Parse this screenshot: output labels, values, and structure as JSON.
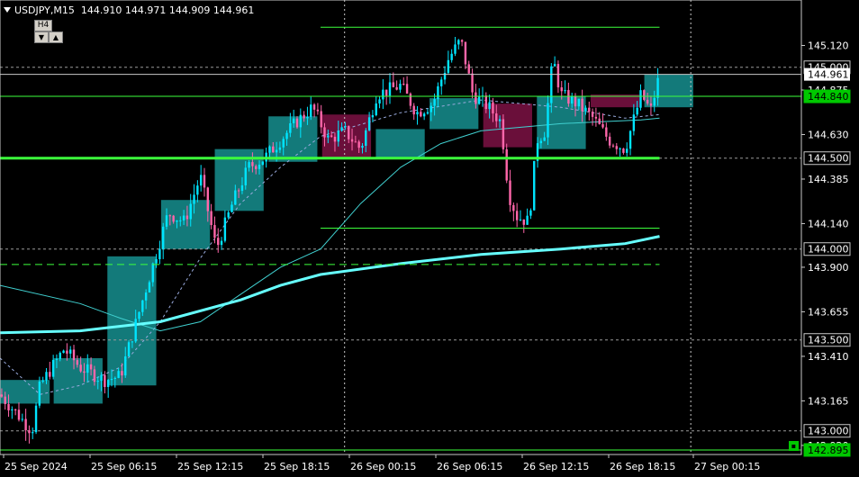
{
  "header": {
    "symbol": "USDJPY,M15",
    "open": "144.910",
    "high": "144.971",
    "low": "144.909",
    "close": "144.961"
  },
  "controls": {
    "timeframe_label": "H4",
    "scroll_left_icon": "triangle-left-icon",
    "scroll_up_icon": "triangle-up-icon",
    "checkbox_label": "▪"
  },
  "colors": {
    "background": "#000000",
    "bull_candle": "#00e5ff",
    "bear_candle": "#ff66aa",
    "bull_zone": "#137a7a",
    "bear_zone": "#6a0f3a",
    "level_line": "#3cff3c",
    "ma_slow": "#66ffff",
    "ma_fast": "#40d0d0",
    "grid": "#c8c8c8"
  },
  "chart_data": {
    "type": "candlestick",
    "ylim": [
      142.87,
      145.37
    ],
    "y_ticks": [
      "145.120",
      "144.875",
      "144.630",
      "144.385",
      "144.140",
      "143.900",
      "143.655",
      "143.410",
      "143.165",
      "142.920"
    ],
    "x_ticks": [
      "25 Sep 2024",
      "25 Sep 06:15",
      "25 Sep 12:15",
      "25 Sep 18:15",
      "26 Sep 00:15",
      "26 Sep 06:15",
      "26 Sep 12:15",
      "26 Sep 18:15",
      "27 Sep 00:15"
    ],
    "price_labels": [
      {
        "value": 145.0,
        "text": "145.000",
        "style": "gray"
      },
      {
        "value": 144.84,
        "text": "144.840",
        "style": "green"
      },
      {
        "value": 144.5,
        "text": "144.500",
        "style": "gray"
      },
      {
        "value": 144.0,
        "text": "144.000",
        "style": "gray"
      },
      {
        "value": 143.5,
        "text": "143.500",
        "style": "gray"
      },
      {
        "value": 143.0,
        "text": "143.000",
        "style": "gray"
      },
      {
        "value": 142.895,
        "text": "142.895",
        "style": "green"
      }
    ],
    "current_price": "144.961",
    "levels": [
      {
        "price": 145.22,
        "from": 0.4,
        "to": 0.823,
        "style": "solid"
      },
      {
        "price": 144.84,
        "from": 0.0,
        "to": 1.0,
        "style": "solid"
      },
      {
        "price": 144.5,
        "from": 0.0,
        "to": 0.823,
        "style": "thick"
      },
      {
        "price": 144.115,
        "from": 0.4,
        "to": 0.823,
        "style": "solid"
      },
      {
        "price": 143.915,
        "from": 0.0,
        "to": 0.823,
        "style": "dashed"
      },
      {
        "price": 142.895,
        "from": 0.0,
        "to": 1.0,
        "style": "solid"
      }
    ],
    "h4_candles": [
      {
        "from": 0.0,
        "to": 0.062,
        "open": 143.15,
        "close": 143.28
      },
      {
        "from": 0.067,
        "to": 0.128,
        "open": 143.15,
        "close": 143.4
      },
      {
        "from": 0.134,
        "to": 0.195,
        "open": 143.25,
        "close": 143.96
      },
      {
        "from": 0.201,
        "to": 0.262,
        "open": 144.0,
        "close": 144.27
      },
      {
        "from": 0.268,
        "to": 0.329,
        "open": 144.21,
        "close": 144.55
      },
      {
        "from": 0.335,
        "to": 0.396,
        "open": 144.48,
        "close": 144.73
      },
      {
        "from": 0.402,
        "to": 0.463,
        "open": 144.74,
        "close": 144.5
      },
      {
        "from": 0.469,
        "to": 0.53,
        "open": 144.5,
        "close": 144.66
      },
      {
        "from": 0.536,
        "to": 0.597,
        "open": 144.66,
        "close": 144.83
      },
      {
        "from": 0.603,
        "to": 0.664,
        "open": 144.8,
        "close": 144.56
      },
      {
        "from": 0.67,
        "to": 0.731,
        "open": 144.55,
        "close": 144.84
      },
      {
        "from": 0.737,
        "to": 0.798,
        "open": 144.85,
        "close": 144.78
      },
      {
        "from": 0.804,
        "to": 0.865,
        "open": 144.78,
        "close": 144.96
      }
    ],
    "m15_anchors": [
      {
        "t": 0.0,
        "p": 143.2
      },
      {
        "t": 0.02,
        "p": 143.1
      },
      {
        "t": 0.04,
        "p": 143.0
      },
      {
        "t": 0.05,
        "p": 143.25
      },
      {
        "t": 0.08,
        "p": 143.45
      },
      {
        "t": 0.1,
        "p": 143.35
      },
      {
        "t": 0.13,
        "p": 143.28
      },
      {
        "t": 0.15,
        "p": 143.3
      },
      {
        "t": 0.17,
        "p": 143.6
      },
      {
        "t": 0.19,
        "p": 143.9
      },
      {
        "t": 0.21,
        "p": 144.2
      },
      {
        "t": 0.23,
        "p": 144.15
      },
      {
        "t": 0.25,
        "p": 144.4
      },
      {
        "t": 0.27,
        "p": 144.0
      },
      {
        "t": 0.29,
        "p": 144.25
      },
      {
        "t": 0.31,
        "p": 144.45
      },
      {
        "t": 0.33,
        "p": 144.5
      },
      {
        "t": 0.35,
        "p": 144.6
      },
      {
        "t": 0.37,
        "p": 144.7
      },
      {
        "t": 0.39,
        "p": 144.78
      },
      {
        "t": 0.41,
        "p": 144.6
      },
      {
        "t": 0.43,
        "p": 144.65
      },
      {
        "t": 0.45,
        "p": 144.55
      },
      {
        "t": 0.47,
        "p": 144.85
      },
      {
        "t": 0.5,
        "p": 144.9
      },
      {
        "t": 0.52,
        "p": 144.75
      },
      {
        "t": 0.54,
        "p": 144.8
      },
      {
        "t": 0.56,
        "p": 145.05
      },
      {
        "t": 0.575,
        "p": 145.15
      },
      {
        "t": 0.59,
        "p": 144.85
      },
      {
        "t": 0.61,
        "p": 144.78
      },
      {
        "t": 0.625,
        "p": 144.7
      },
      {
        "t": 0.635,
        "p": 144.3
      },
      {
        "t": 0.645,
        "p": 144.18
      },
      {
        "t": 0.66,
        "p": 144.15
      },
      {
        "t": 0.67,
        "p": 144.6
      },
      {
        "t": 0.68,
        "p": 144.65
      },
      {
        "t": 0.69,
        "p": 145.05
      },
      {
        "t": 0.7,
        "p": 144.85
      },
      {
        "t": 0.72,
        "p": 144.8
      },
      {
        "t": 0.74,
        "p": 144.72
      },
      {
        "t": 0.76,
        "p": 144.6
      },
      {
        "t": 0.78,
        "p": 144.55
      },
      {
        "t": 0.8,
        "p": 144.85
      },
      {
        "t": 0.812,
        "p": 144.76
      },
      {
        "t": 0.823,
        "p": 144.96
      }
    ],
    "ma_fast": [
      {
        "t": 0.0,
        "p": 143.8
      },
      {
        "t": 0.1,
        "p": 143.7
      },
      {
        "t": 0.15,
        "p": 143.62
      },
      {
        "t": 0.2,
        "p": 143.55
      },
      {
        "t": 0.25,
        "p": 143.6
      },
      {
        "t": 0.3,
        "p": 143.75
      },
      {
        "t": 0.35,
        "p": 143.9
      },
      {
        "t": 0.4,
        "p": 144.0
      },
      {
        "t": 0.45,
        "p": 144.25
      },
      {
        "t": 0.5,
        "p": 144.45
      },
      {
        "t": 0.55,
        "p": 144.58
      },
      {
        "t": 0.6,
        "p": 144.65
      },
      {
        "t": 0.65,
        "p": 144.67
      },
      {
        "t": 0.7,
        "p": 144.69
      },
      {
        "t": 0.75,
        "p": 144.7
      },
      {
        "t": 0.8,
        "p": 144.71
      },
      {
        "t": 0.823,
        "p": 144.72
      }
    ],
    "ma_slow": [
      {
        "t": 0.0,
        "p": 143.54
      },
      {
        "t": 0.1,
        "p": 143.55
      },
      {
        "t": 0.2,
        "p": 143.6
      },
      {
        "t": 0.3,
        "p": 143.72
      },
      {
        "t": 0.35,
        "p": 143.8
      },
      {
        "t": 0.4,
        "p": 143.86
      },
      {
        "t": 0.5,
        "p": 143.92
      },
      {
        "t": 0.6,
        "p": 143.97
      },
      {
        "t": 0.7,
        "p": 144.0
      },
      {
        "t": 0.78,
        "p": 144.03
      },
      {
        "t": 0.823,
        "p": 144.07
      }
    ],
    "ma_dashed": [
      {
        "t": 0.0,
        "p": 143.4
      },
      {
        "t": 0.05,
        "p": 143.2
      },
      {
        "t": 0.1,
        "p": 143.25
      },
      {
        "t": 0.15,
        "p": 143.35
      },
      {
        "t": 0.2,
        "p": 143.6
      },
      {
        "t": 0.25,
        "p": 143.95
      },
      {
        "t": 0.3,
        "p": 144.25
      },
      {
        "t": 0.35,
        "p": 144.45
      },
      {
        "t": 0.4,
        "p": 144.62
      },
      {
        "t": 0.5,
        "p": 144.75
      },
      {
        "t": 0.6,
        "p": 144.82
      },
      {
        "t": 0.7,
        "p": 144.78
      },
      {
        "t": 0.78,
        "p": 144.72
      },
      {
        "t": 0.823,
        "p": 144.74
      }
    ]
  }
}
